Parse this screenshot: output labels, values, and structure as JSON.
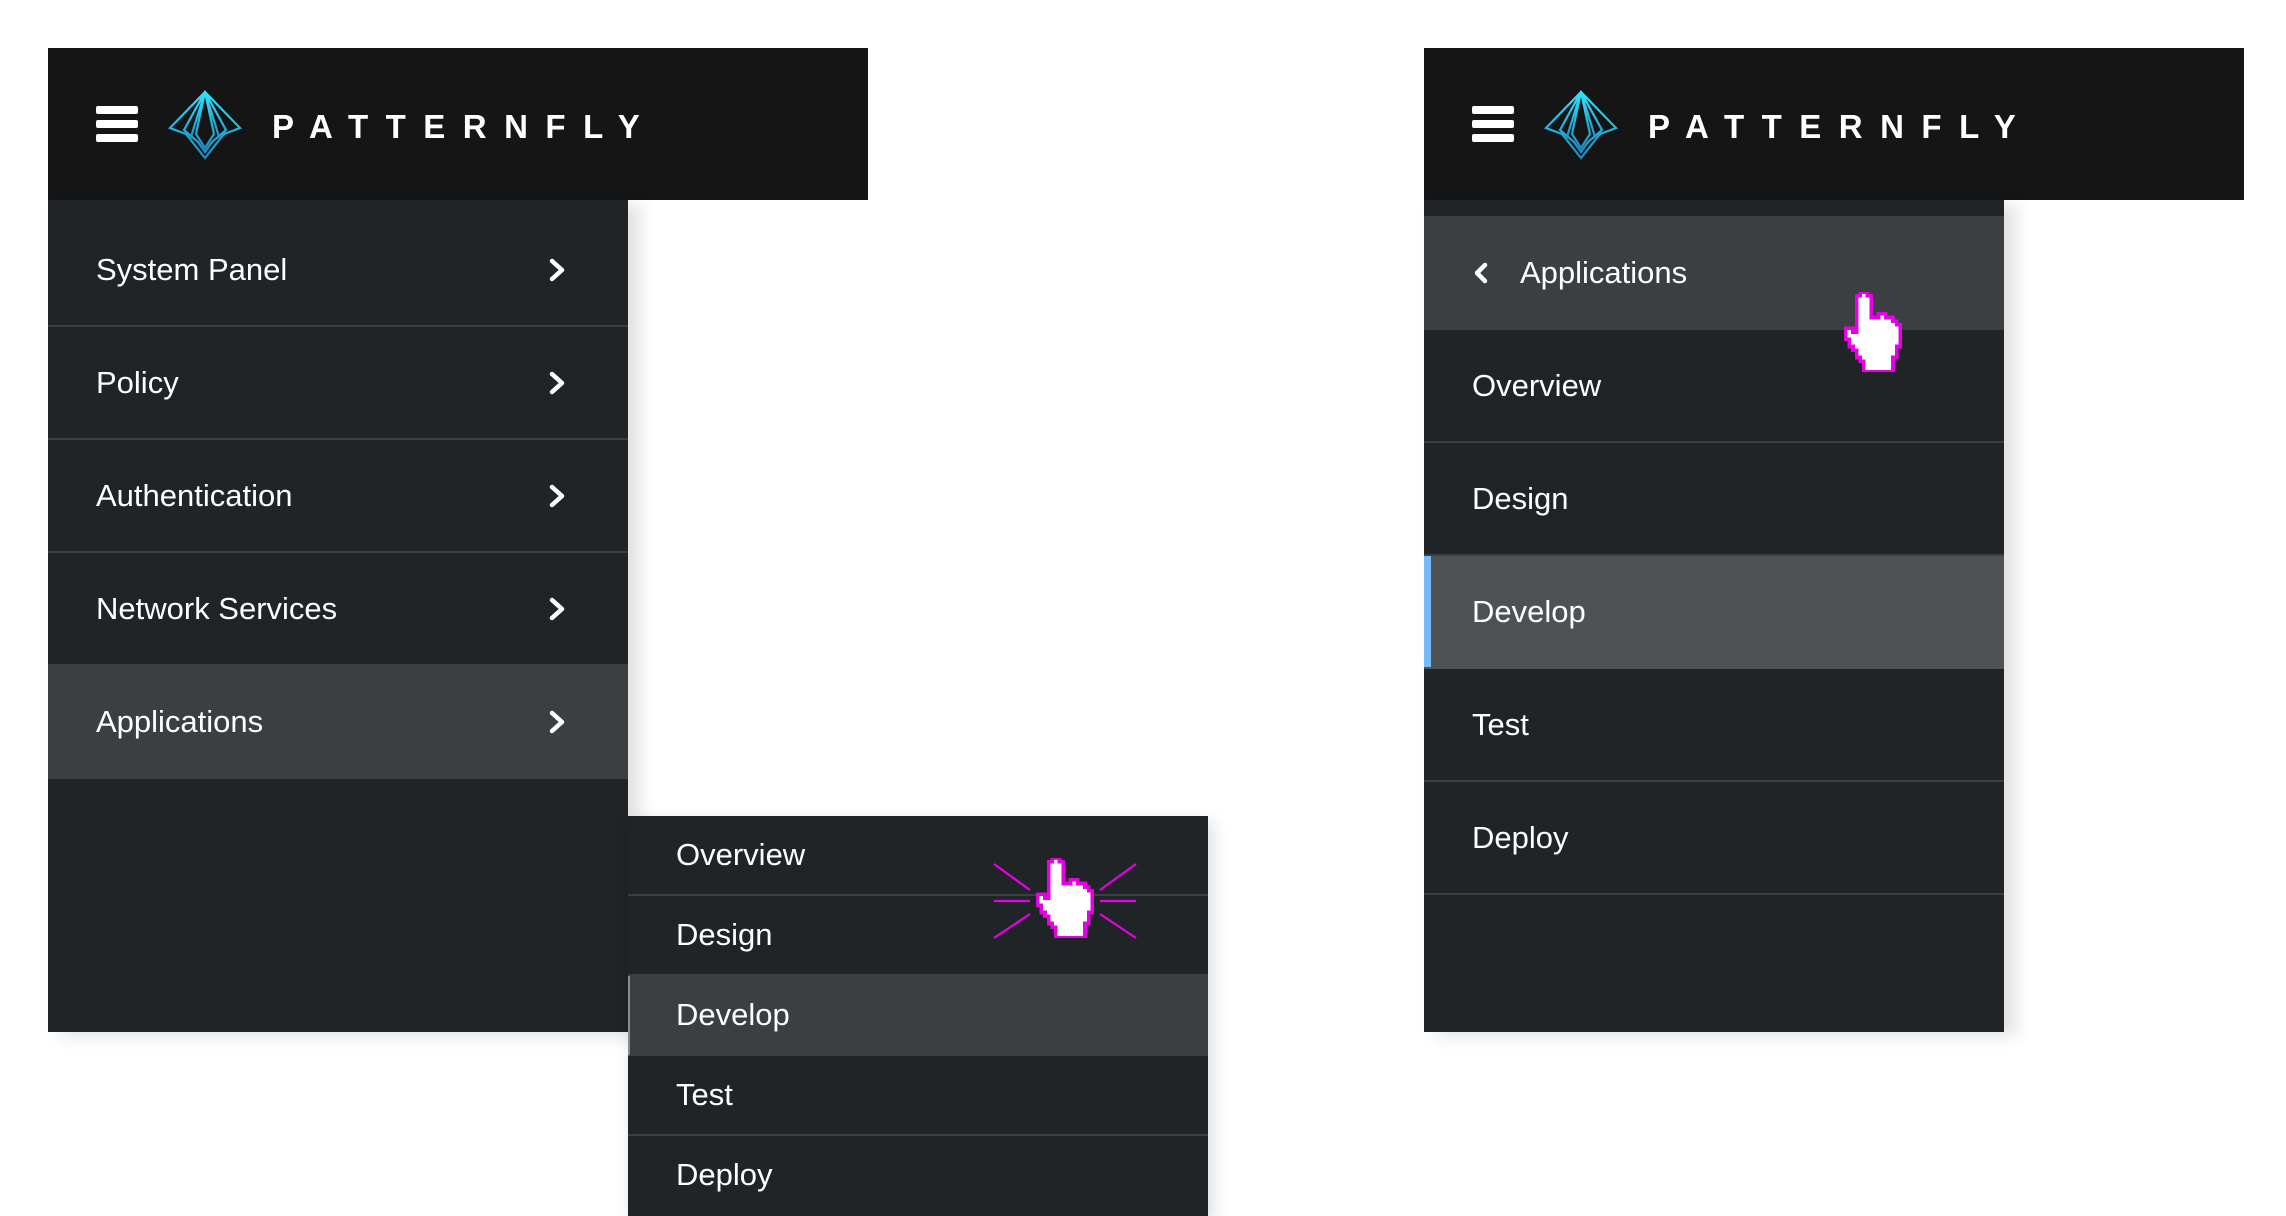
{
  "brand": {
    "name": "PATTERNFLY",
    "accent_color": "#2bc4ed"
  },
  "left_example": {
    "description": "flyout navigation",
    "header": {
      "menu_icon": "hamburger-icon",
      "logo_icon": "patternfly-logo-icon",
      "brand": "PATTERNFLY"
    },
    "nav_items": [
      {
        "label": "System Panel",
        "icon": "chevron-right-icon"
      },
      {
        "label": "Policy",
        "icon": "chevron-right-icon"
      },
      {
        "label": "Authentication",
        "icon": "chevron-right-icon"
      },
      {
        "label": "Network Services",
        "icon": "chevron-right-icon"
      },
      {
        "label": "Applications",
        "icon": "chevron-right-icon",
        "current": true
      }
    ],
    "flyout_items": [
      {
        "label": "Overview"
      },
      {
        "label": "Design"
      },
      {
        "label": "Develop",
        "hover": true
      },
      {
        "label": "Test"
      },
      {
        "label": "Deploy"
      }
    ],
    "cursor": "pointer-hand-click-icon"
  },
  "right_example": {
    "description": "drilldown navigation",
    "header": {
      "menu_icon": "hamburger-icon",
      "logo_icon": "patternfly-logo-icon",
      "brand": "PATTERNFLY"
    },
    "back_item": {
      "label": "Applications",
      "icon": "chevron-left-icon"
    },
    "items": [
      {
        "label": "Overview"
      },
      {
        "label": "Design"
      },
      {
        "label": "Develop",
        "current": true
      },
      {
        "label": "Test"
      },
      {
        "label": "Deploy"
      }
    ],
    "cursor": "pointer-hand-icon"
  },
  "colors": {
    "masthead": "#151515",
    "nav_background": "#212427",
    "nav_hover": "#3c3f42",
    "nav_current": "#4f5255",
    "current_indicator": "#73bcf7",
    "cursor_outline": "#e600e6"
  }
}
